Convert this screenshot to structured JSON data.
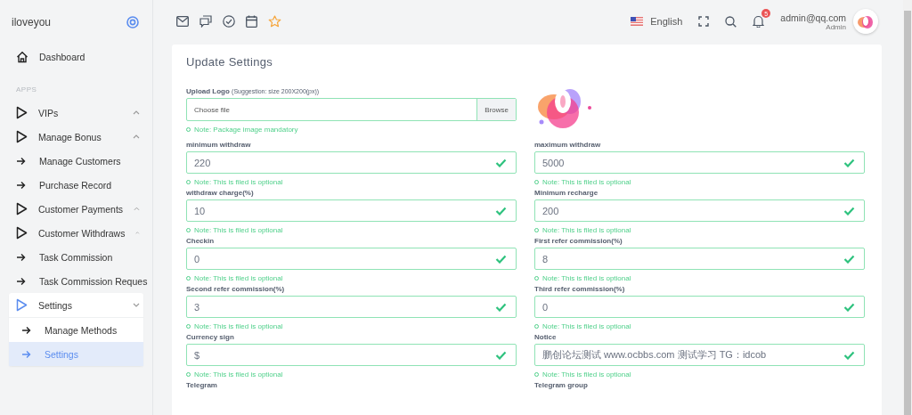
{
  "sidebar": {
    "brand": "iloveyou",
    "section_label": "APPS",
    "items": [
      {
        "kind": "home",
        "label": "Dashboard"
      },
      {
        "kind": "section"
      },
      {
        "kind": "group",
        "label": "VIPs",
        "expanded": false
      },
      {
        "kind": "group",
        "label": "Manage Bonus",
        "expanded": false
      },
      {
        "kind": "link",
        "label": "Manage Customers"
      },
      {
        "kind": "link",
        "label": "Purchase Record"
      },
      {
        "kind": "group",
        "label": "Customer Payments",
        "expanded": false
      },
      {
        "kind": "group",
        "label": "Customer Withdraws",
        "expanded": false
      },
      {
        "kind": "link",
        "label": "Task Commission"
      },
      {
        "kind": "link",
        "label": "Task Commission Reques"
      },
      {
        "kind": "group",
        "label": "Settings",
        "expanded": true,
        "children": [
          {
            "label": "Manage Methods",
            "selected": false
          },
          {
            "label": "Settings",
            "selected": true
          }
        ]
      }
    ]
  },
  "topbar": {
    "language": "English",
    "notification_count": "5",
    "user_email": "admin@qq.com",
    "user_role": "Admin"
  },
  "form": {
    "title": "Update Settings",
    "upload": {
      "label": "Upload Logo",
      "hint": "(Suggestion: size 200X200(px))",
      "placeholder": "Choose file",
      "button": "Browse",
      "note": "Note: Package image mandatory"
    },
    "fields": [
      {
        "label": "minimum withdraw",
        "value": "220",
        "valid": true,
        "note": "Note: This is filed is optional"
      },
      {
        "label": "maximum withdraw",
        "value": "5000",
        "valid": true,
        "note": "Note: This is filed is optional"
      },
      {
        "label": "withdraw charge(%)",
        "value": "10",
        "valid": true,
        "note": "Note: This is filed is optional"
      },
      {
        "label": "Minimum recharge",
        "value": "200",
        "valid": true,
        "note": "Note: This is filed is optional"
      },
      {
        "label": "Checkin",
        "value": "0",
        "valid": true,
        "note": "Note: This is filed is optional"
      },
      {
        "label": "First refer commission(%)",
        "value": "8",
        "valid": true,
        "note": "Note: This is filed is optional"
      },
      {
        "label": "Second refer commission(%)",
        "value": "3",
        "valid": true,
        "note": "Note: This is filed is optional"
      },
      {
        "label": "Third refer commission(%)",
        "value": "0",
        "valid": true,
        "note": "Note: This is filed is optional"
      },
      {
        "label": "Currency sign",
        "value": "$",
        "valid": true,
        "note": "Note: This is filed is optional"
      },
      {
        "label": "Notice",
        "value": "鹏创论坛测试 www.ocbbs.com  测试学习  TG：idcob",
        "valid": true,
        "note": "Note: This is filed is optional"
      },
      {
        "label": "Telegram"
      },
      {
        "label": "Telegram group"
      }
    ]
  }
}
